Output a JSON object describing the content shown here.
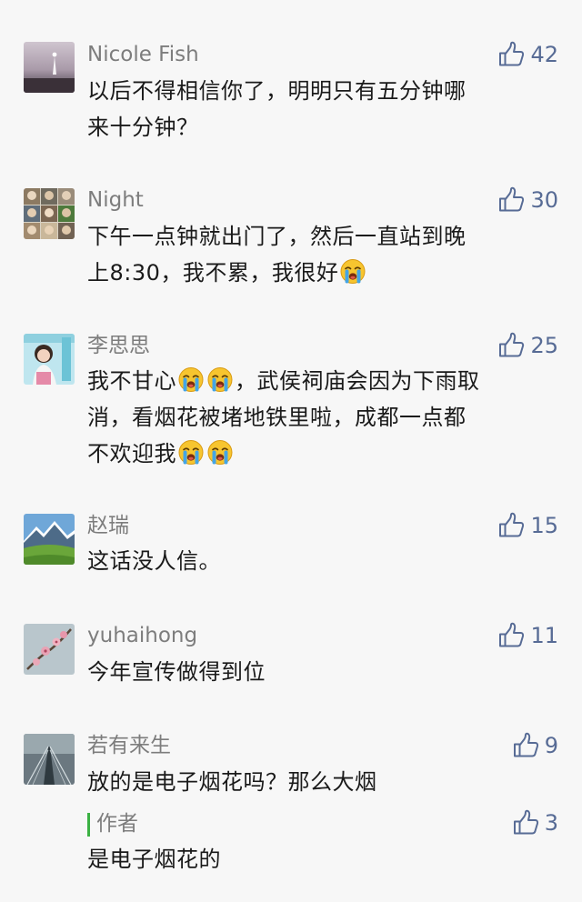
{
  "comments": [
    {
      "name": "Nicole Fish",
      "likes": "42",
      "lines": [
        "以后不得相信你了，明明只有五分钟哪",
        "来十分钟？"
      ]
    },
    {
      "name": "Night",
      "likes": "30",
      "lines": [
        "下午一点钟就出门了，然后一直站到晚",
        "上8:30，我不累，我很好"
      ]
    },
    {
      "name": "李思思",
      "likes": "25",
      "lines": [
        "我不甘心",
        "，武侯祠庙会因为下雨取",
        "消，看烟花被堵地铁里啦，成都一点都",
        "不欢迎我"
      ]
    },
    {
      "name": "赵瑞",
      "likes": "15",
      "lines": [
        "这话没人信。"
      ]
    },
    {
      "name": "yuhaihong",
      "likes": "11",
      "lines": [
        "今年宣传做得到位"
      ]
    },
    {
      "name": "若有来生",
      "likes": "9",
      "lines": [
        "放的是电子烟花吗？那么大烟"
      ]
    }
  ],
  "reply": {
    "name": "作者",
    "likes": "3",
    "text": "是电子烟花的"
  },
  "icons": {
    "like": "thumbs-up-icon",
    "emoji": "crying-face-icon"
  },
  "colors": {
    "like": "#576b95",
    "name": "#7d7d7d",
    "author_bar": "#3bb143"
  }
}
